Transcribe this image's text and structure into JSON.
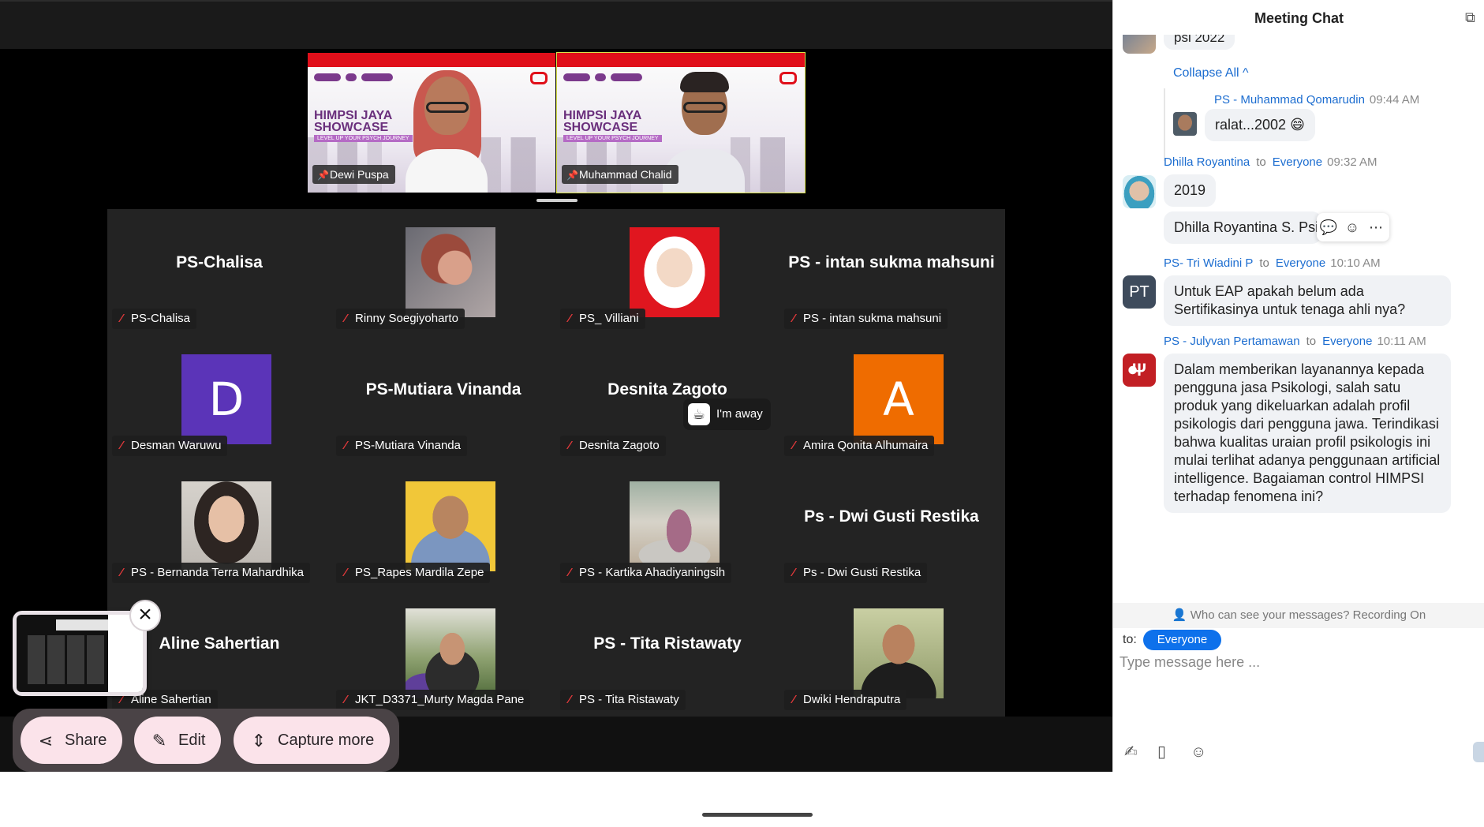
{
  "speakers": [
    {
      "name": "Dewi Puspa",
      "banner_title": "HIMPSI JAYA SHOWCASE",
      "banner_sub": "LEVEL UP YOUR PSYCH JOURNEY",
      "pin_icon": "pin-icon"
    },
    {
      "name": "Muhammad Chalid",
      "banner_title": "HIMPSI JAYA SHOWCASE",
      "banner_sub": "LEVEL UP YOUR PSYCH JOURNEY",
      "pin_icon": "pin-icon",
      "active": true
    }
  ],
  "gallery": [
    {
      "display": "PS-Chalisa",
      "label": "PS-Chalisa",
      "muted": true
    },
    {
      "display": "",
      "label": "Rinny Soegiyoharto",
      "muted": true,
      "photo": "rinny"
    },
    {
      "display": "",
      "label": "PS_ Villiani",
      "muted": true,
      "photo": "villiani"
    },
    {
      "display": "PS - intan sukma mahsuni",
      "label": "PS - intan sukma mahsuni",
      "muted": true
    },
    {
      "display": "",
      "label": "Desman Waruwu",
      "muted": true,
      "letter": "D",
      "color": "#5b34b8"
    },
    {
      "display": "PS-Mutiara Vinanda",
      "label": "PS-Mutiara Vinanda",
      "muted": true
    },
    {
      "display": "Desnita Zagoto",
      "label": "Desnita Zagoto",
      "muted": true
    },
    {
      "display": "",
      "label": "Amira Qonita Alhumaira",
      "muted": true,
      "letter": "A",
      "color": "#ef6c00"
    },
    {
      "display": "",
      "label": "PS - Bernanda Terra Mahardhika",
      "muted": true,
      "photo": "bernanda"
    },
    {
      "display": "",
      "label": "PS_Rapes Mardila Zepe",
      "muted": true,
      "photo": "rapes"
    },
    {
      "display": "",
      "label": "PS - Kartika Ahadiyaningsih",
      "muted": true,
      "photo": "kartika"
    },
    {
      "display": "Ps - Dwi Gusti Restika",
      "label": "Ps - Dwi Gusti Restika",
      "muted": true
    },
    {
      "display": "Aline Sahertian",
      "label": "Aline Sahertian",
      "muted": true
    },
    {
      "display": "",
      "label": "JKT_D3371_Murty Magda Pane",
      "muted": true,
      "photo": "murty"
    },
    {
      "display": "PS - Tita Ristawaty",
      "label": "PS - Tita Ristawaty",
      "muted": true
    },
    {
      "display": "",
      "label": "Dwiki Hendraputra",
      "muted": true,
      "photo": "dwiki"
    }
  ],
  "away_status": "I'm away",
  "screenshot_toolbar": {
    "close": "×",
    "share": "Share",
    "edit": "Edit",
    "capture_more": "Capture more"
  },
  "chat": {
    "title": "Meeting Chat",
    "popout_icon": "popout-icon",
    "top_fragment": "psi 2022",
    "collapse_all": "Collapse All ^",
    "reply": {
      "sender": "PS - Muhammad Qomarudin",
      "time": "09:44 AM",
      "text": "ralat...2002 😄"
    },
    "messages": [
      {
        "sender": "Dhilla Royantina",
        "to_word": "to",
        "recipient": "Everyone",
        "time": "09:32 AM",
        "bubbles": [
          "2019",
          "Dhilla Royantina S. Psi."
        ]
      },
      {
        "sender": "PS- Tri Wiadini P",
        "to_word": "to",
        "recipient": "Everyone",
        "time": "10:10 AM",
        "avatar_text": "PT",
        "bubbles": [
          "Untuk EAP apakah belum ada Sertifikasinya untuk tenaga ahli nya?"
        ]
      },
      {
        "sender": "PS - Julyvan Pertamawan",
        "to_word": "to",
        "recipient": "Everyone",
        "time": "10:11 AM",
        "avatar_text": "Ψ",
        "bubbles": [
          "Dalam memberikan layanannya kepada pengguna jasa Psikologi, salah satu produk yang dikeluarkan adalah profil psikologis dari pengguna jawa. Terindikasi bahwa kualitas uraian profil psikologis ini mulai terlihat adanya penggunaan artificial intelligence. Bagaiaman control HIMPSI terhadap fenomena ini?"
        ]
      }
    ],
    "privacy_notice": "Who can see your messages? Recording On",
    "to_label": "to:",
    "to_value": "Everyone",
    "input_placeholder": "Type message here ..."
  },
  "colors": {
    "accent": "#0e71eb",
    "sender_blue": "#1c6dd0",
    "muted_mic": "#e5393b",
    "active_speaker": "#d9e34a"
  }
}
